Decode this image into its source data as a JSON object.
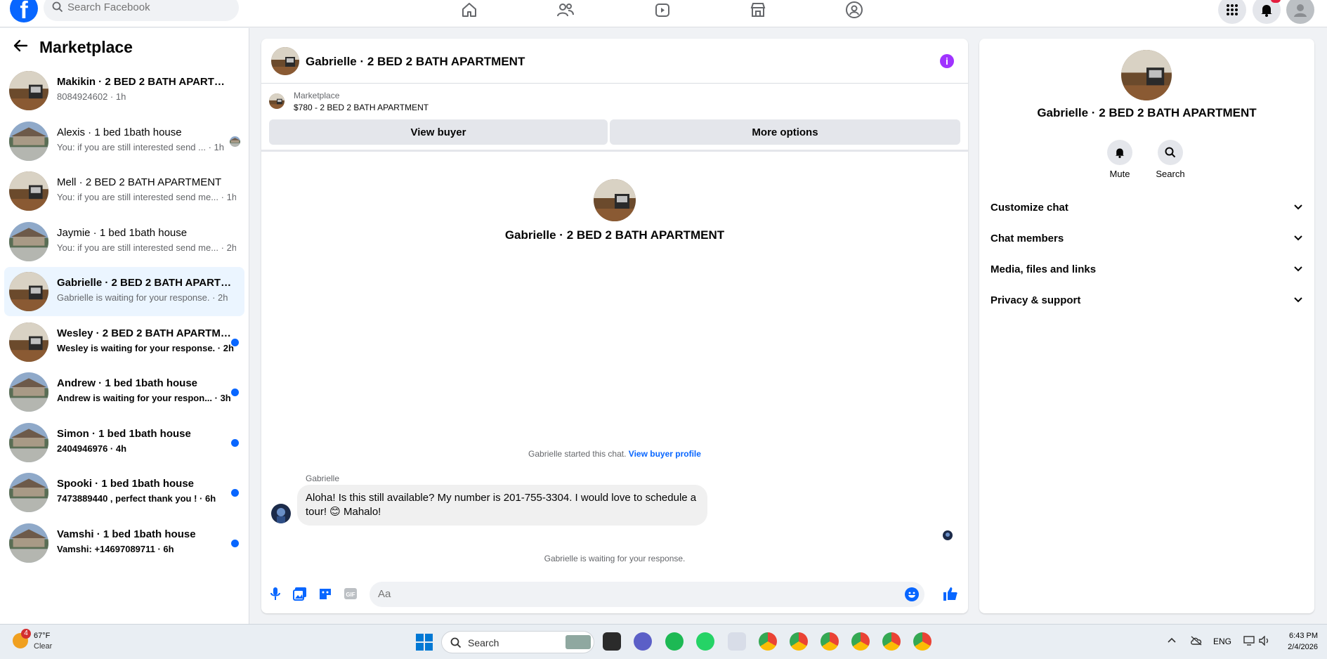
{
  "topbar": {
    "logo": "f",
    "search_placeholder": "Search Facebook",
    "icons": [
      "home-icon",
      "friends-icon",
      "watch-icon",
      "marketplace-icon",
      "groups-icon",
      "menu-grid-icon",
      "bell-icon",
      "avatar"
    ]
  },
  "sidebar": {
    "title": "Marketplace",
    "conversations": [
      {
        "name": "Makikin · 2 BED 2 BATH APARTMENT",
        "snippet": "8084924602 · 1h",
        "unread": false,
        "photo": "apartment"
      },
      {
        "name": "Alexis · 1 bed 1bath house",
        "snippet": "You: if you are still interested send ... · 1h",
        "unread": false,
        "photo": "house"
      },
      {
        "name": "Mell · 2 BED 2 BATH APARTMENT",
        "snippet": "You: if you are still interested send me... · 1h",
        "unread": false,
        "photo": "apartment"
      },
      {
        "name": "Jaymie · 1 bed 1bath house",
        "snippet": "You: if you are still interested send me... · 2h",
        "unread": false,
        "photo": "house"
      },
      {
        "name": "Gabrielle · 2 BED 2 BATH APARTMENT",
        "snippet": "Gabrielle is waiting for your response. · 2h",
        "unread": false,
        "photo": "apartment",
        "active": true
      },
      {
        "name": "Wesley · 2 BED 2 BATH APARTMENT",
        "snippet": "Wesley is waiting for your response. · 2h",
        "unread": true,
        "photo": "apartment"
      },
      {
        "name": "Andrew · 1 bed 1bath house",
        "snippet": "Andrew is waiting for your respon... · 3h",
        "unread": true,
        "photo": "house"
      },
      {
        "name": "Simon · 1 bed 1bath house",
        "snippet": "2404946976 · 4h",
        "unread": true,
        "photo": "house"
      },
      {
        "name": "Spooki · 1 bed 1bath house",
        "snippet": "7473889440 , perfect thank you ! · 6h",
        "unread": true,
        "photo": "house"
      },
      {
        "name": "Vamshi · 1 bed 1bath house",
        "snippet": "Vamshi: +14697089711 · 6h",
        "unread": true,
        "photo": "house"
      }
    ]
  },
  "chat": {
    "title": "Gabrielle · 2 BED 2 BATH APARTMENT",
    "listing_label": "Marketplace",
    "listing_item": "$780 - 2 BED 2 BATH APARTMENT",
    "view_buyer": "View buyer",
    "more_options": "More options",
    "profile_name": "Gabrielle · 2 BED 2 BATH APARTMENT",
    "started_text": "Gabrielle started this chat.",
    "view_buyer_profile": "View buyer profile",
    "sender": "Gabrielle",
    "message": "Aloha! Is this still available? My number is 201-755-3304. I would love to schedule a tour! 😊 Mahalo!",
    "waiting": "Gabrielle is waiting for your response.",
    "composer_placeholder": "Aa"
  },
  "right_panel": {
    "name": "Gabrielle · 2 BED 2 BATH APARTMENT",
    "mute": "Mute",
    "search": "Search",
    "sections": [
      "Customize chat",
      "Chat members",
      "Media, files and links",
      "Privacy & support"
    ]
  },
  "taskbar": {
    "weather_badge": "4",
    "temperature": "67°F",
    "condition": "Clear",
    "search": "Search",
    "lang": "ENG",
    "time": "6:43 PM",
    "date": "2/4/2026"
  },
  "colors": {
    "brand": "#0866ff",
    "unread_dot": "#0866ff",
    "info": "#a033ff",
    "active_row": "#ebf5ff"
  }
}
